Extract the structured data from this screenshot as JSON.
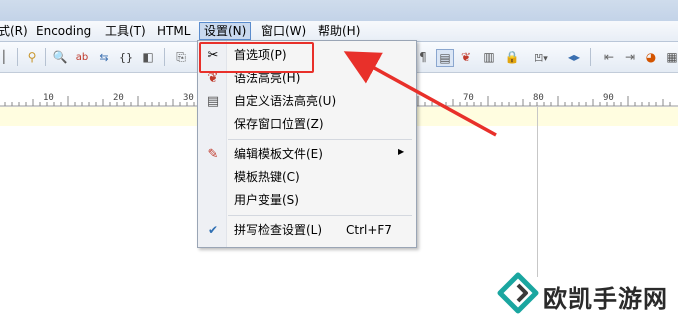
{
  "menubar": {
    "items": [
      "式(R)",
      "Encoding",
      "工具(T)",
      "HTML",
      "设置(N)",
      "窗口(W)",
      "帮助(H)"
    ]
  },
  "ruler": {
    "numbers": [
      "10",
      "20",
      "30",
      "70",
      "80",
      "90"
    ]
  },
  "dropdown": {
    "items": [
      {
        "label": "首选项(P)",
        "icon": "scissors-wrench-icon"
      },
      {
        "label": "语法高亮(H)",
        "icon": "syntax-highlight-icon"
      },
      {
        "label": "自定义语法高亮(U)",
        "icon": "custom-syntax-icon"
      },
      {
        "label": "保存窗口位置(Z)",
        "icon": ""
      },
      {
        "label": "编辑模板文件(E)",
        "icon": "edit-template-icon"
      },
      {
        "label": "模板热键(C)",
        "icon": ""
      },
      {
        "label": "用户变量(S)",
        "icon": ""
      },
      {
        "label": "拼写检查设置(L)",
        "icon": "spellcheck-icon",
        "shortcut": "Ctrl+F7"
      }
    ]
  },
  "watermark": {
    "text": "欧凯手游网"
  },
  "colors": {
    "highlight": "#e8302a",
    "menu_active": "#c9d9ef"
  }
}
